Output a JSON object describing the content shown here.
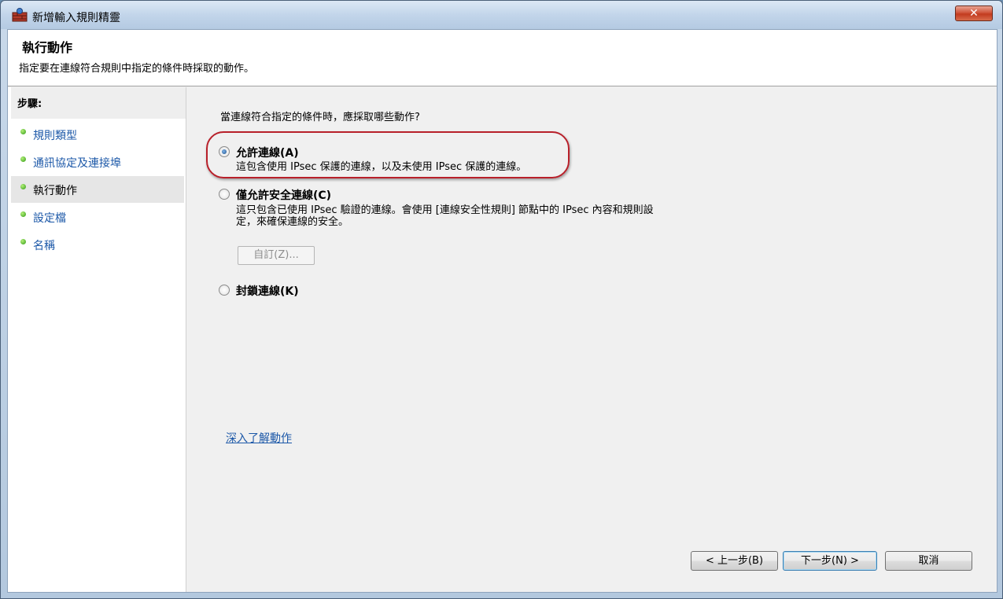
{
  "window": {
    "title": "新增輸入規則精靈",
    "close_label": "✕"
  },
  "header": {
    "title": "執行動作",
    "subtitle": "指定要在連線符合規則中指定的條件時採取的動作。"
  },
  "sidebar": {
    "heading": "步驟:",
    "items": [
      {
        "label": "規則類型"
      },
      {
        "label": "通訊協定及連接埠"
      },
      {
        "label": "執行動作"
      },
      {
        "label": "設定檔"
      },
      {
        "label": "名稱"
      }
    ]
  },
  "main": {
    "question": "當連線符合指定的條件時，應採取哪些動作?",
    "options": [
      {
        "label": "允許連線(A)",
        "desc": "這包含使用 IPsec 保護的連線，以及未使用 IPsec 保護的連線。",
        "checked": true
      },
      {
        "label": "僅允許安全連線(C)",
        "desc_line1": "這只包含已使用 IPsec 驗證的連線。會使用 [連線安全性規則] 節點中的 IPsec 內容和規則設",
        "desc_line2": "定，來確保連線的安全。",
        "checked": false
      },
      {
        "label": "封鎖連線(K)",
        "checked": false
      }
    ],
    "custom_button": "自訂(Z)...",
    "learn_more": "深入了解動作"
  },
  "buttons": {
    "back": "< 上一步(B)",
    "next": "下一步(N) >",
    "cancel": "取消"
  }
}
